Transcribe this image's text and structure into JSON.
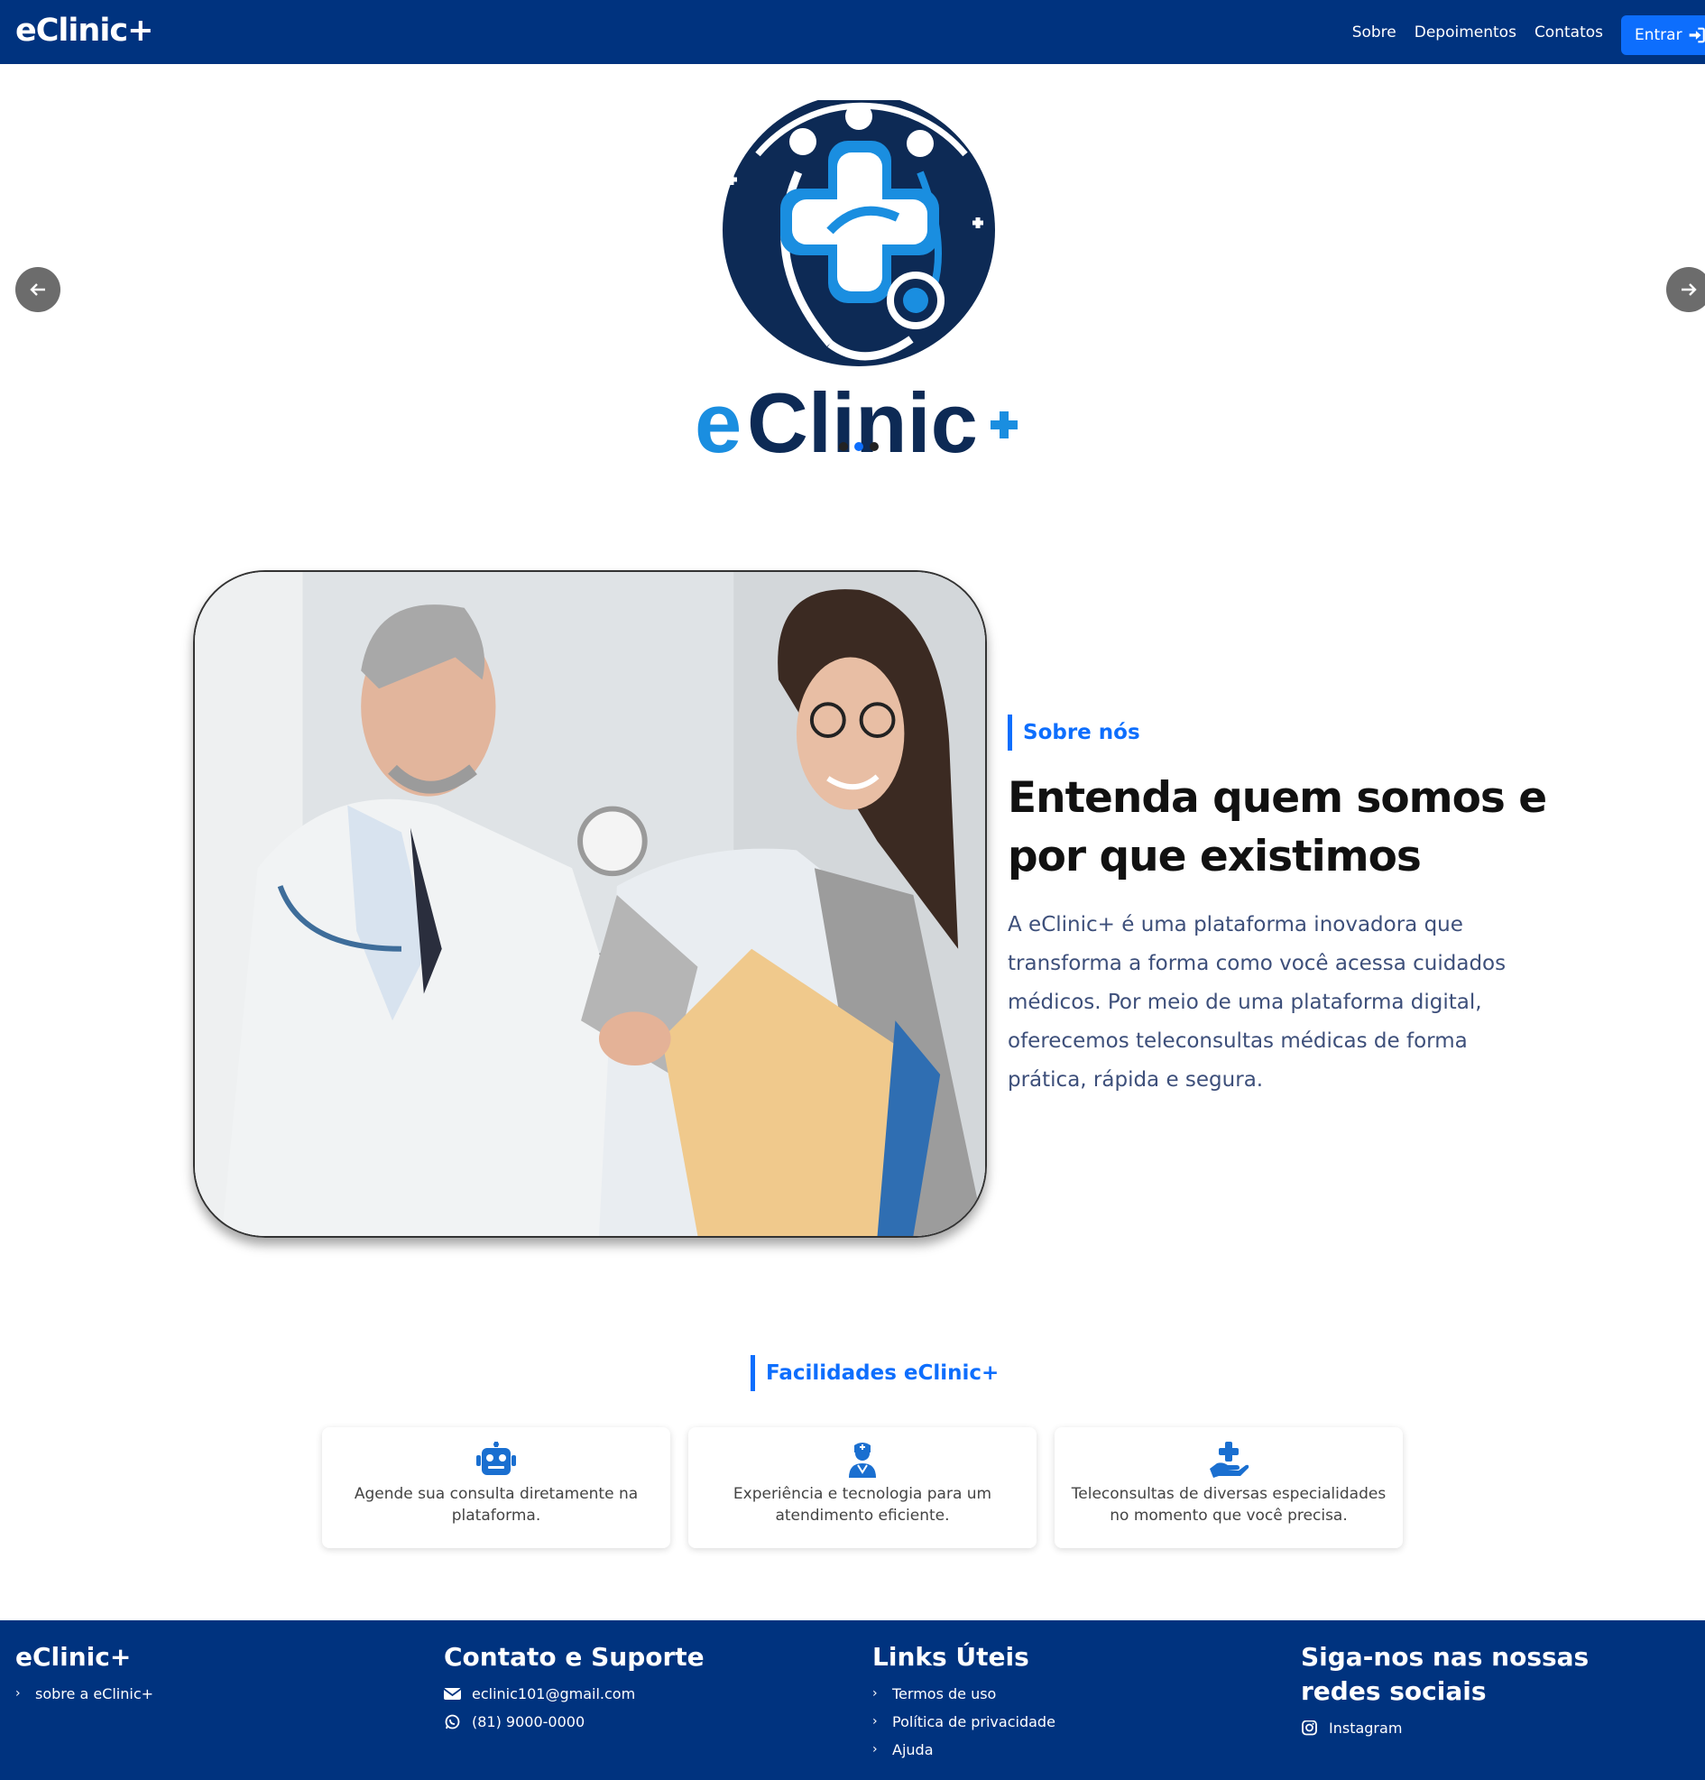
{
  "header": {
    "brand": "eClinic+",
    "nav": [
      "Sobre",
      "Depoimentos",
      "Contatos"
    ],
    "login_label": "Entrar"
  },
  "carousel": {
    "logo_text": "eClinic+",
    "slide_count": 3,
    "active_slide": 2
  },
  "about": {
    "tag": "Sobre nós",
    "title": "Entenda quem somos e por que existimos",
    "text": "A eClinic+ é uma plataforma inovadora que transforma a forma como você acessa cuidados médicos. Por meio de uma plataforma digital, oferecemos teleconsultas médicas de forma prática, rápida e segura."
  },
  "features": {
    "tag": "Facilidades eClinic+",
    "cards": [
      {
        "icon": "robot-icon",
        "text": "Agende sua consulta diretamente na plataforma."
      },
      {
        "icon": "doctor-icon",
        "text": "Experiência e tecnologia para um atendimento eficiente."
      },
      {
        "icon": "hand-holding-medical-icon",
        "text": "Teleconsultas de diversas especialidades no momento que você precisa."
      }
    ]
  },
  "footer": {
    "col1": {
      "title": "eClinic+",
      "links": [
        "sobre a eClinic+"
      ]
    },
    "col2": {
      "title": "Contato e Suporte",
      "email": "eclinic101@gmail.com",
      "phone": "(81) 9000-0000"
    },
    "col3": {
      "title": "Links Úteis",
      "links": [
        "Termos de uso",
        "Política de privacidade",
        "Ajuda"
      ]
    },
    "col4": {
      "title": "Siga-nos nas nossas redes sociais",
      "instagram": "Instagram"
    }
  },
  "colors": {
    "primary": "#00337f",
    "accent": "#0d6efd"
  }
}
